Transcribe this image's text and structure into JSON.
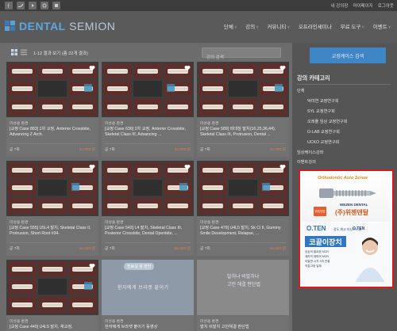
{
  "topbar": {
    "socials": [
      "facebook-icon",
      "twitter-icon",
      "youtube-icon",
      "instagram-icon",
      "blog-icon"
    ],
    "links": [
      "내 강의장",
      "마이페이지",
      "로그아웃"
    ]
  },
  "header": {
    "logo_brand": "DENTAL",
    "logo_sub": "SEMION",
    "nav": [
      {
        "label": "단체",
        "dropdown": true
      },
      {
        "label": "강의",
        "dropdown": true
      },
      {
        "label": "커뮤니티",
        "dropdown": true
      },
      {
        "label": "오프라인세미나",
        "dropdown": false
      },
      {
        "label": "무료 도구",
        "dropdown": true
      },
      {
        "label": "이벤트",
        "dropdown": true
      }
    ]
  },
  "toolbar": {
    "result_count": "1-12 결과 보기 (총 22개 결과)",
    "search_placeholder": "강의 검색"
  },
  "cards": [
    {
      "category": "미성용 환경",
      "title": "[교정 Case 883] 1차 교정, Anterior Crossbite, Advancing Z Arch.",
      "count": "곧 7화",
      "price": "22,000 원"
    },
    {
      "category": "미성용 환경",
      "title": "[교정 Case 636] 1차 교정, Anterior Crossbite, Skeletal Class III, Advancing ...",
      "count": "곧 7화",
      "price": "22,000 원"
    },
    {
      "category": "미성용 환경",
      "title": "[교정 Case 589] 비대칭 발치(16,25,36,44), Skeletal Class III, Protrusion, Dental ...",
      "count": "곧 7화",
      "price": "44,000 원"
    },
    {
      "category": "미성용 환경",
      "title": "[교정 Case 555] U5L4 발치, Skeletal Class II, Protrusion, Short Root #34.",
      "count": "곧 7화",
      "price": "44,000 원"
    },
    {
      "category": "미성용 환경",
      "title": "[교정 Case 543] L4 발치, Skeletal Class III, Posterior Crossbite, Dental Openbite, ...",
      "count": "곧 7화",
      "price": "66,000 원"
    },
    {
      "category": "미성용 환경",
      "title": "[교정 Case 476] U4L5 발치, Sk Cl II, Gummy Smile Development, Relapse, ...",
      "count": "곧 7화",
      "price": "44,000 원"
    },
    {
      "category": "미성용 환경",
      "title": "[교정 Case 440] U4L5 발치, 재교정,",
      "count": "",
      "price": ""
    },
    {
      "category": "미성용 환경",
      "title": "한자에게 브라켓 붙이기 동영상",
      "count": "",
      "price": ""
    },
    {
      "category": "미성용 환경",
      "title": "발치 비발치 고민해결 판단법",
      "count": "",
      "price": ""
    }
  ],
  "card_thumb_text": {
    "card8": "환자에게 브라켓 붙이기",
    "card9_line1": "발치냐 비발치냐",
    "card9_line2": "고민 해결 판단법",
    "card8_badge": "진료실 왕 편한"
  },
  "sidebar": {
    "button": "교정케이스 검색",
    "title": "강의 카테고리",
    "items": [
      {
        "label": "단체",
        "level": 0
      },
      {
        "label": "덕미연 교정연구회",
        "level": 1
      },
      {
        "label": "SYL 교정연구회",
        "level": 1
      },
      {
        "label": "오레풀 임상 교정연구회",
        "level": 1
      },
      {
        "label": "O-LAB 교정연구회",
        "level": 1
      },
      {
        "label": "UCKO 교정연구회",
        "level": 1
      },
      {
        "label": "임상케이스강좌",
        "level": 0
      },
      {
        "label": "이벤트강의",
        "level": 0
      }
    ]
  },
  "ad": {
    "top_brand": "Orthodontic Auto Screw",
    "top_company_en": "WEZEN DENTAL",
    "top_company_kr": "(주)위젠덴탈",
    "top_badge": "위젠덴탈",
    "bot_logo": "O.TEN",
    "bot_slogan": "강도 최고 미니스크류",
    "bot_big": "코끝이장치",
    "bot_bullets": [
      "임상의 필요한 MCR",
      "세라믹 에피어 MCR",
      "이발판 시자 3개 연결",
      "직접고정 일체"
    ],
    "bot_tag": "O.TEN"
  },
  "colors": {
    "accent": "#3f86c6",
    "price": "#e07a5a",
    "ad_border": "#e0161b"
  }
}
